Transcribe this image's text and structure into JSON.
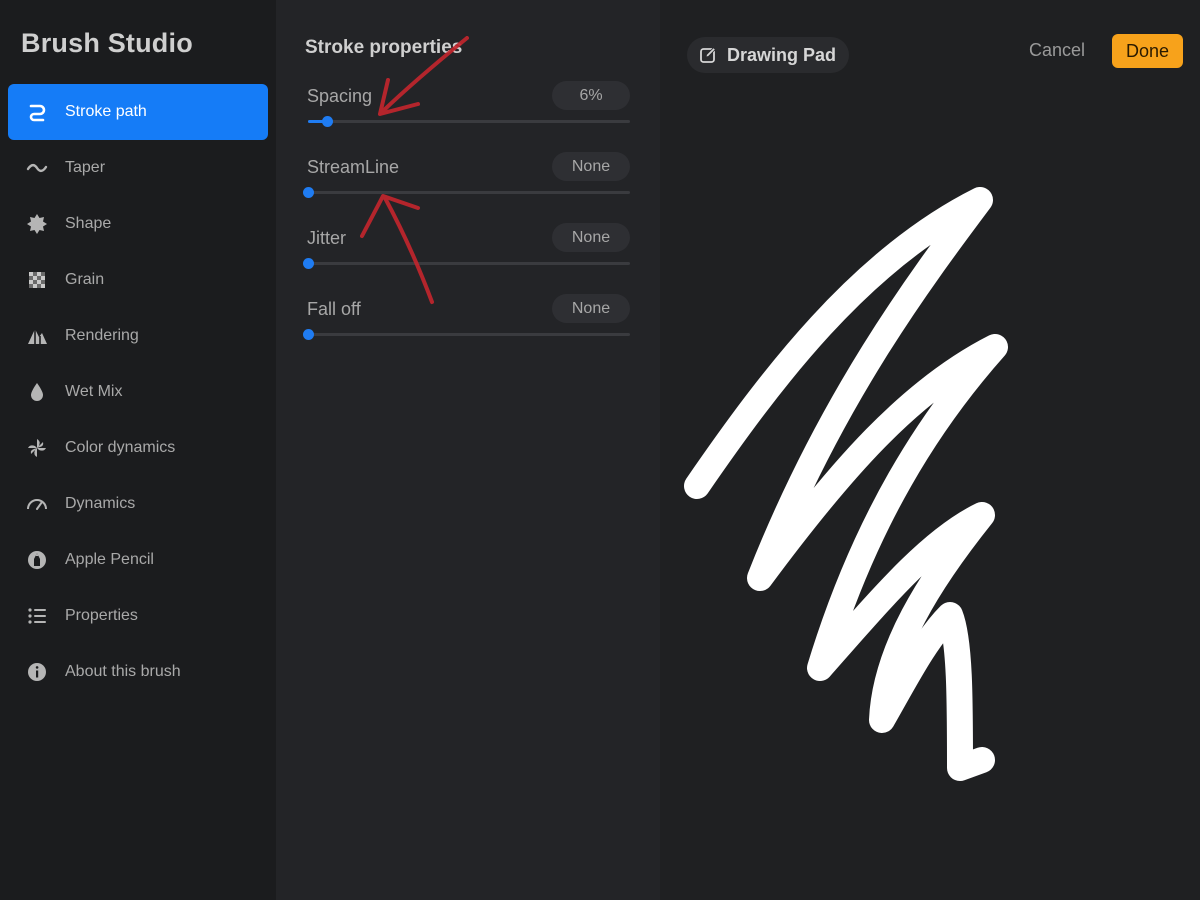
{
  "app": {
    "title": "Brush Studio"
  },
  "sidebar": {
    "items": [
      {
        "label": "Stroke path",
        "icon": "stroke-path-icon",
        "active": true
      },
      {
        "label": "Taper",
        "icon": "taper-icon",
        "active": false
      },
      {
        "label": "Shape",
        "icon": "shape-icon",
        "active": false
      },
      {
        "label": "Grain",
        "icon": "grain-icon",
        "active": false
      },
      {
        "label": "Rendering",
        "icon": "rendering-icon",
        "active": false
      },
      {
        "label": "Wet Mix",
        "icon": "wet-mix-icon",
        "active": false
      },
      {
        "label": "Color dynamics",
        "icon": "color-dynamics-icon",
        "active": false
      },
      {
        "label": "Dynamics",
        "icon": "dynamics-icon",
        "active": false
      },
      {
        "label": "Apple Pencil",
        "icon": "apple-pencil-icon",
        "active": false
      },
      {
        "label": "Properties",
        "icon": "properties-icon",
        "active": false
      },
      {
        "label": "About this brush",
        "icon": "info-icon",
        "active": false
      }
    ]
  },
  "panel": {
    "title": "Stroke properties",
    "settings": [
      {
        "label": "Spacing",
        "value": "6%",
        "fraction": 0.06
      },
      {
        "label": "StreamLine",
        "value": "None",
        "fraction": 0
      },
      {
        "label": "Jitter",
        "value": "None",
        "fraction": 0
      },
      {
        "label": "Fall off",
        "value": "None",
        "fraction": 0
      }
    ]
  },
  "pad": {
    "title": "Drawing Pad",
    "cancel_label": "Cancel",
    "done_label": "Done"
  },
  "colors": {
    "accent": "#157cf7",
    "done": "#f7a21b",
    "annotation": "#c4262d"
  }
}
